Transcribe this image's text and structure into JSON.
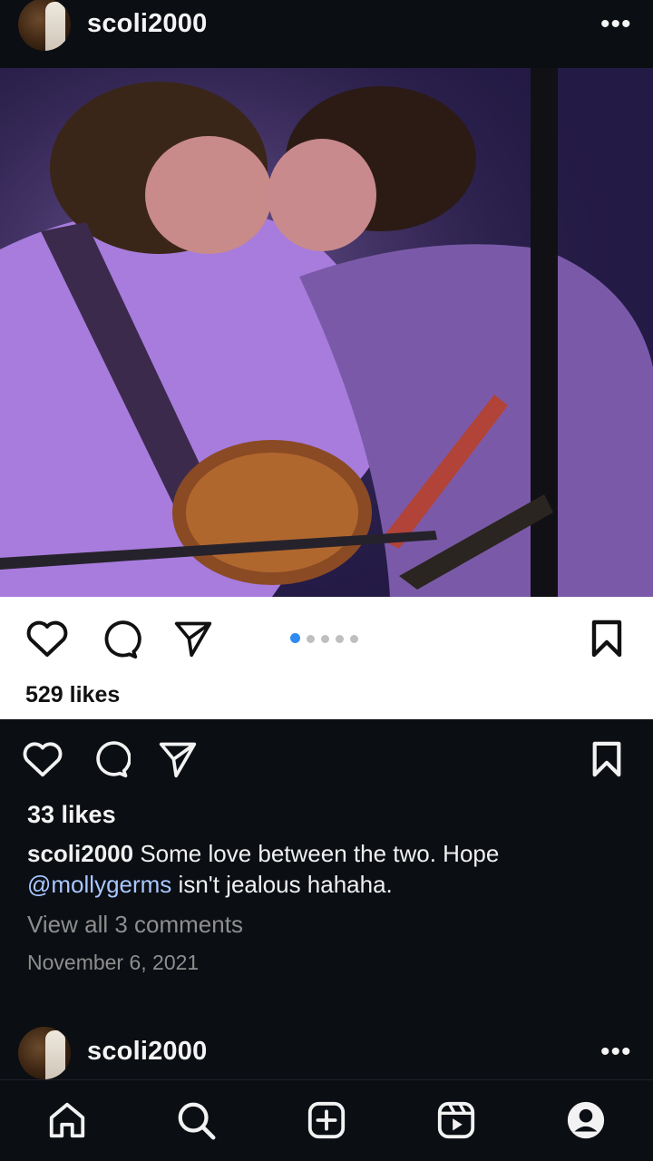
{
  "post": {
    "username": "scoli2000",
    "more_label": "•••"
  },
  "photo": {
    "pager_count": 5,
    "pager_active": 1
  },
  "inner_post": {
    "likes": "529 likes"
  },
  "outer_post": {
    "likes": "33 likes",
    "caption_user": "scoli2000",
    "caption_text": " Some love between the two. Hope ",
    "mention": "@mollygerms",
    "caption_tail": " isn't jealous hahaha.",
    "view_comments": "View all 3 comments",
    "date": "November 6, 2021"
  },
  "next_post": {
    "username": "scoli2000",
    "more_label": "•••"
  },
  "colors": {
    "background": "#0b0e13",
    "mention": "#a9c7ff",
    "pager_active": "#2f8bf1"
  },
  "nav": {
    "items": [
      "home-icon",
      "search-icon",
      "create-icon",
      "reels-icon",
      "profile-icon"
    ]
  }
}
